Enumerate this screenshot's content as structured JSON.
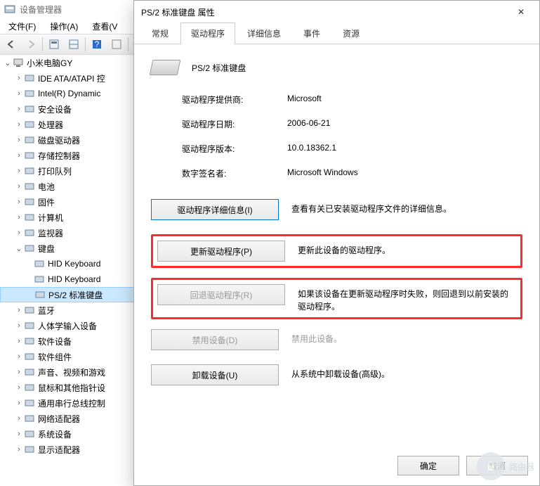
{
  "dm": {
    "title": "设备管理器",
    "menus": [
      "文件(F)",
      "操作(A)",
      "查看(V"
    ],
    "root": "小米电脑GY",
    "nodes": [
      {
        "label": "IDE ATA/ATAPI 控",
        "icon": "ide"
      },
      {
        "label": "Intel(R) Dynamic",
        "icon": "chip"
      },
      {
        "label": "安全设备",
        "icon": "shield"
      },
      {
        "label": "处理器",
        "icon": "cpu"
      },
      {
        "label": "磁盘驱动器",
        "icon": "disk"
      },
      {
        "label": "存储控制器",
        "icon": "storage"
      },
      {
        "label": "打印队列",
        "icon": "printer"
      },
      {
        "label": "电池",
        "icon": "battery"
      },
      {
        "label": "固件",
        "icon": "firmware"
      },
      {
        "label": "计算机",
        "icon": "computer"
      },
      {
        "label": "监视器",
        "icon": "monitor"
      },
      {
        "label": "键盘",
        "icon": "keyboard",
        "expanded": true,
        "children": [
          {
            "label": "HID Keyboard",
            "icon": "keyboard"
          },
          {
            "label": "HID Keyboard",
            "icon": "keyboard"
          },
          {
            "label": "PS/2 标准键盘",
            "icon": "keyboard",
            "selected": true
          }
        ]
      },
      {
        "label": "蓝牙",
        "icon": "bluetooth"
      },
      {
        "label": "人体学输入设备",
        "icon": "hid"
      },
      {
        "label": "软件设备",
        "icon": "software"
      },
      {
        "label": "软件组件",
        "icon": "component"
      },
      {
        "label": "声音、视频和游戏",
        "icon": "sound"
      },
      {
        "label": "鼠标和其他指针设",
        "icon": "mouse"
      },
      {
        "label": "通用串行总线控制",
        "icon": "usb"
      },
      {
        "label": "网络适配器",
        "icon": "network"
      },
      {
        "label": "系统设备",
        "icon": "system"
      },
      {
        "label": "显示适配器",
        "icon": "display"
      }
    ]
  },
  "dlg": {
    "title": "PS/2 标准键盘 属性",
    "tabs": [
      "常规",
      "驱动程序",
      "详细信息",
      "事件",
      "资源"
    ],
    "active_tab": 1,
    "device_name": "PS/2 标准键盘",
    "props": {
      "provider_label": "驱动程序提供商:",
      "provider_value": "Microsoft",
      "date_label": "驱动程序日期:",
      "date_value": "2006-06-21",
      "version_label": "驱动程序版本:",
      "version_value": "10.0.18362.1",
      "signer_label": "数字签名者:",
      "signer_value": "Microsoft Windows"
    },
    "actions": {
      "details_btn": "驱动程序详细信息(I)",
      "details_desc": "查看有关已安装驱动程序文件的详细信息。",
      "update_btn": "更新驱动程序(P)",
      "update_desc": "更新此设备的驱动程序。",
      "rollback_btn": "回退驱动程序(R)",
      "rollback_desc": "如果该设备在更新驱动程序时失败，则回退到以前安装的驱动程序。",
      "disable_btn": "禁用设备(D)",
      "disable_desc": "禁用此设备。",
      "uninstall_btn": "卸载设备(U)",
      "uninstall_desc": "从系统中卸载设备(高级)。"
    },
    "ok": "确定",
    "cancel": "取消"
  },
  "watermark": "路由器"
}
